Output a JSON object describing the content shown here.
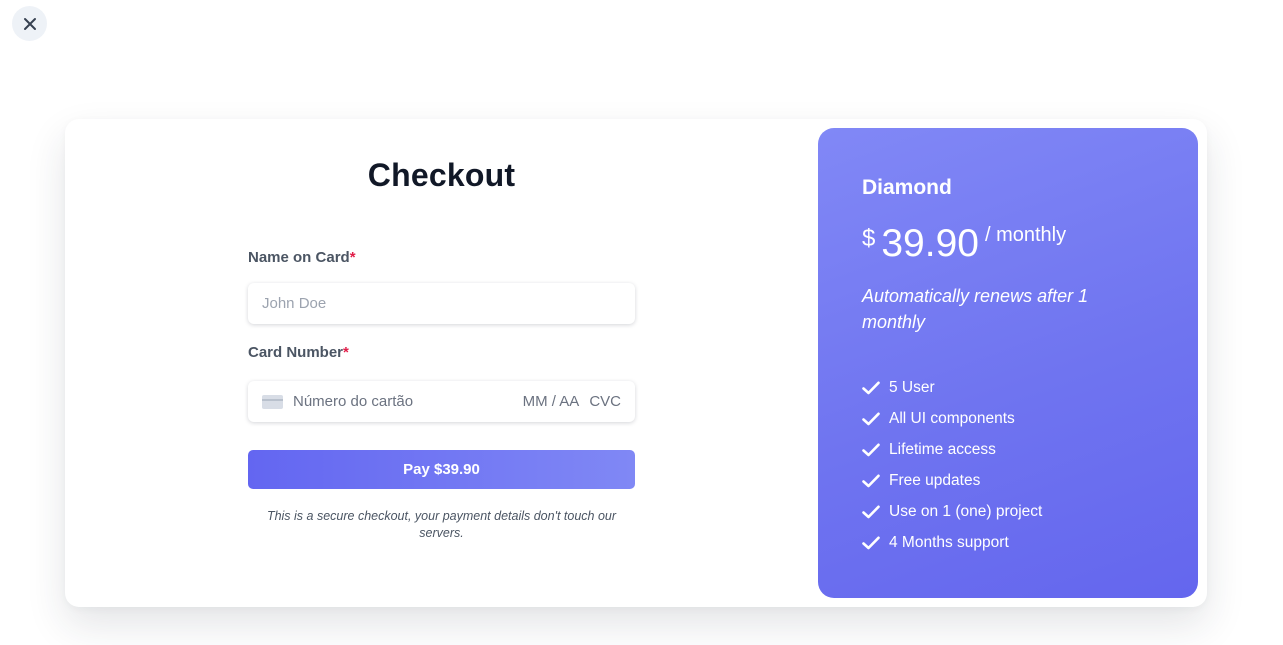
{
  "close": {
    "icon": "close-icon"
  },
  "checkout": {
    "title": "Checkout",
    "name_label": "Name on Card",
    "name_placeholder": "John Doe",
    "card_label": "Card Number",
    "required_mark": "*",
    "card_placeholder": "Número do cartão",
    "expiry_placeholder": "MM / AA",
    "cvc_placeholder": "CVC",
    "pay_label": "Pay $39.90",
    "secure_note": "This is a secure checkout, your payment details don't touch our servers."
  },
  "plan": {
    "name": "Diamond",
    "currency": "$",
    "amount": "39.90",
    "period": "/ monthly",
    "renew_note": "Automatically renews after 1 monthly",
    "features": [
      "5 User",
      "All UI components",
      "Lifetime access",
      "Free updates",
      "Use on 1 (one) project",
      "4 Months support"
    ],
    "colors": {
      "gradient_start": "#8188f6",
      "gradient_end": "#6466ee"
    }
  }
}
